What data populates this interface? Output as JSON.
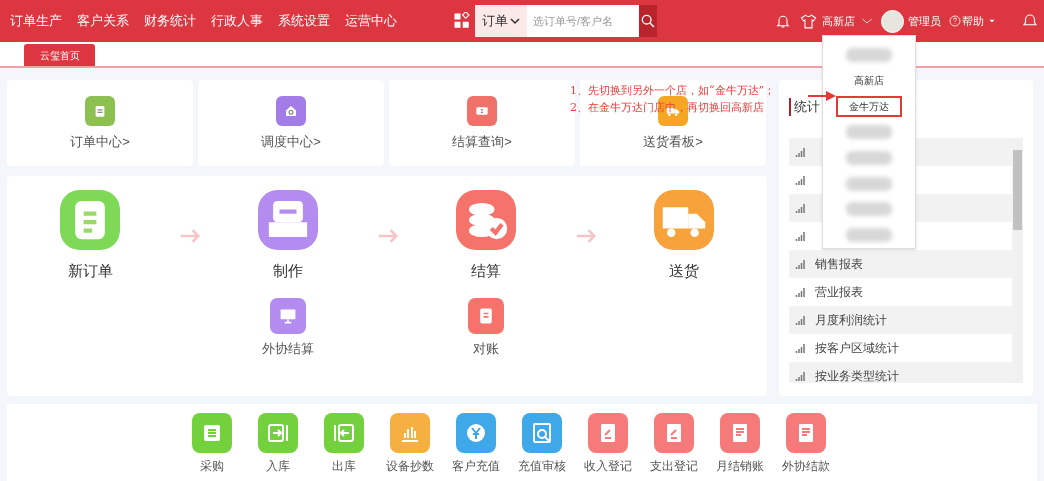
{
  "nav": [
    "订单生产",
    "客户关系",
    "财务统计",
    "行政人事",
    "系统设置",
    "运营中心"
  ],
  "search": {
    "scope": "订单",
    "placeholder": "选订单号/客户名"
  },
  "header": {
    "store": "高新店",
    "user": "管理员",
    "help": "帮助"
  },
  "tabs": [
    {
      "label": "云玺首页",
      "selected": true
    }
  ],
  "quick_links": [
    {
      "label": "订单中心>",
      "color": "#8cc152"
    },
    {
      "label": "调度中心>",
      "color": "#a47ce8"
    },
    {
      "label": "结算查询>",
      "color": "#f0706a"
    },
    {
      "label": "送货看板>",
      "color": "#f5a623"
    }
  ],
  "flow": {
    "steps": [
      {
        "label": "新订单",
        "color": "#7ed957"
      },
      {
        "label": "制作",
        "color": "#b48cf0"
      },
      {
        "label": "结算",
        "color": "#f5736b"
      },
      {
        "label": "送货",
        "color": "#f7a23a"
      }
    ],
    "sub_steps": [
      {
        "label": "外协结算",
        "color": "#b48cf0"
      },
      {
        "label": "对账",
        "color": "#f5736b"
      }
    ]
  },
  "stats": {
    "title": "统计",
    "items": [
      {
        "kind": "covered"
      },
      {
        "kind": "covered"
      },
      {
        "kind": "covered"
      },
      {
        "kind": "covered"
      },
      {
        "kind": "report",
        "label": "销售报表"
      },
      {
        "kind": "report",
        "label": "营业报表"
      },
      {
        "kind": "report",
        "label": "月度利润统计"
      },
      {
        "kind": "report",
        "label": "按客户区域统计"
      },
      {
        "kind": "report",
        "label": "按业务类型统计"
      }
    ]
  },
  "store_menu": [
    {
      "kind": "blurred",
      "selected": false
    },
    {
      "kind": "store",
      "label": "高新店",
      "selected": false
    },
    {
      "kind": "store",
      "label": "金牛万达",
      "selected": true
    },
    {
      "kind": "blurred",
      "selected": false
    },
    {
      "kind": "blurred",
      "selected": false
    },
    {
      "kind": "blurred",
      "selected": false
    },
    {
      "kind": "blurred",
      "selected": false
    },
    {
      "kind": "blurred",
      "selected": false
    }
  ],
  "annotation": [
    "1、先切换到另外一个店，如“金牛万达”；",
    "2、在金牛万达门店中，再切换回高新店"
  ],
  "shortcuts": [
    {
      "label": "采购",
      "color": "#73d13d"
    },
    {
      "label": "入库",
      "color": "#73d13d"
    },
    {
      "label": "出库",
      "color": "#73d13d"
    },
    {
      "label": "设备抄数",
      "color": "#f5b041"
    },
    {
      "label": "客户充值",
      "color": "#3ea8e8"
    },
    {
      "label": "充值审核",
      "color": "#3ea8e8"
    },
    {
      "label": "收入登记",
      "color": "#f77a7a"
    },
    {
      "label": "支出登记",
      "color": "#f77a7a"
    },
    {
      "label": "月结销账",
      "color": "#f77a7a"
    },
    {
      "label": "外协结款",
      "color": "#f77a7a"
    }
  ]
}
